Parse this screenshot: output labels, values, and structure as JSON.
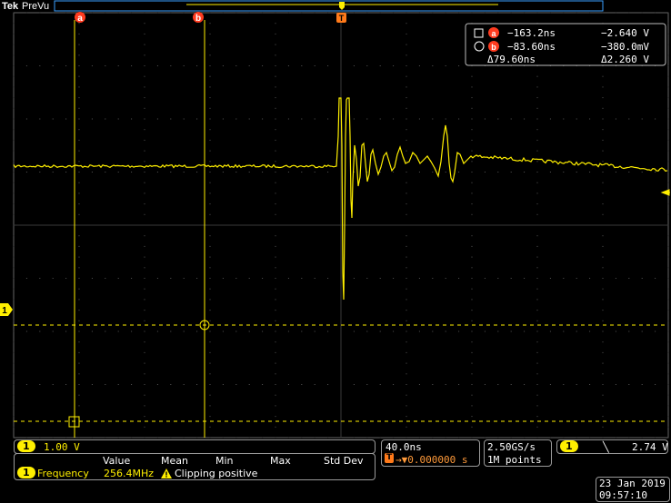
{
  "header": {
    "brand": "Tek",
    "mode": "PreVu"
  },
  "cursor_markers": {
    "a": "a",
    "b": "b",
    "trigger": "T",
    "ch1": "1"
  },
  "cursor_readout": {
    "a_time": "−163.2ns",
    "a_volt": "−2.640 V",
    "b_time": "−83.60ns",
    "b_volt": "−380.0mV",
    "delta_time": "Δ79.60ns",
    "delta_volt": "Δ2.260 V"
  },
  "channel": {
    "num": "1",
    "scale": "1.00 V"
  },
  "measure": {
    "headers": [
      "Value",
      "Mean",
      "Min",
      "Max",
      "Std Dev"
    ],
    "name": "Frequency",
    "value": "256.4MHz",
    "warning": "Clipping positive"
  },
  "timebase": {
    "scale": "40.0ns",
    "delay": "→▼0.000000 s",
    "trigger_icon": "T"
  },
  "acquisition": {
    "rate": "2.50GS/s",
    "points": "1M points"
  },
  "trigger": {
    "source": "1",
    "slope": "╲",
    "level": "2.74 V"
  },
  "datetime": {
    "date": "23 Jan  2019",
    "time": "09:57:10"
  },
  "colors": {
    "trace": "#ffef00",
    "grid": "#5a5a5a",
    "marker": "#ff3b1f",
    "cursor": "#ffef00"
  },
  "icons": {
    "cursor_a": "square-icon",
    "cursor_b": "circle-icon",
    "warning": "warning-triangle-icon"
  }
}
